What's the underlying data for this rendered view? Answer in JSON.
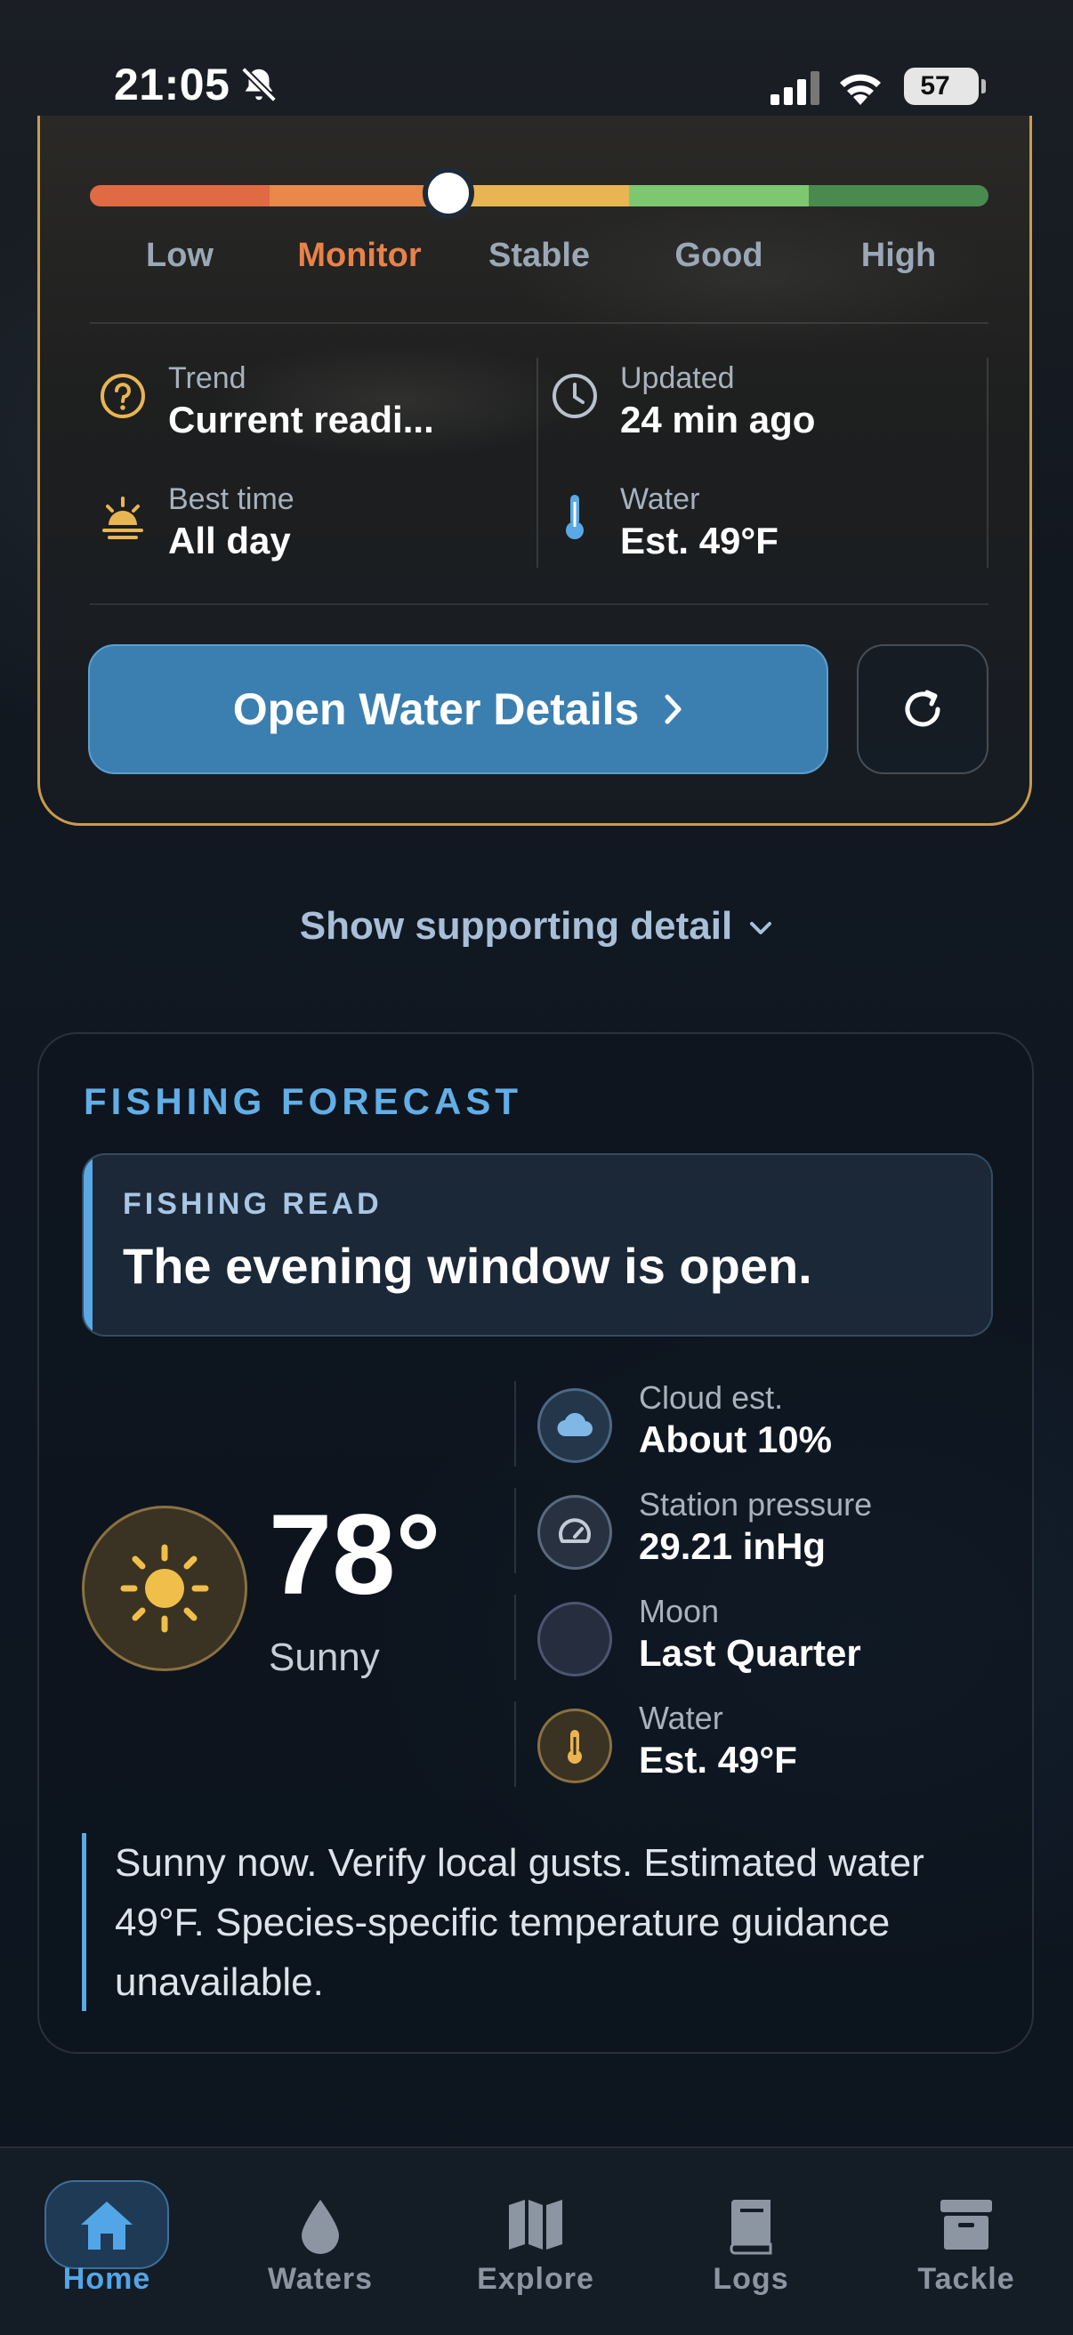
{
  "status_bar": {
    "time": "21:05",
    "battery": "57"
  },
  "water_card": {
    "scale": {
      "labels": [
        "Low",
        "Monitor",
        "Stable",
        "Good",
        "High"
      ],
      "active": "Monitor",
      "colors": [
        "#e06a44",
        "#e8884a",
        "#e9b552",
        "#7ec771",
        "#4a8a4e"
      ]
    },
    "trend": {
      "label": "Trend",
      "value": "Current readi..."
    },
    "updated": {
      "label": "Updated",
      "value": "24 min ago"
    },
    "best_time": {
      "label": "Best time",
      "value": "All day"
    },
    "water": {
      "label": "Water",
      "value": "Est. 49°F"
    },
    "open_button": "Open Water Details"
  },
  "show_detail": "Show supporting detail",
  "forecast": {
    "title": "FISHING FORECAST",
    "read_label": "FISHING READ",
    "read_text": "The evening window is open.",
    "temperature": "78°",
    "condition": "Sunny",
    "stats": [
      {
        "label": "Cloud est.",
        "value": "About 10%",
        "icon": "cloud-icon"
      },
      {
        "label": "Station pressure",
        "value": "29.21 inHg",
        "icon": "gauge-icon"
      },
      {
        "label": "Moon",
        "value": "Last Quarter",
        "icon": "moon-icon"
      },
      {
        "label": "Water",
        "value": "Est. 49°F",
        "icon": "thermometer-icon"
      }
    ],
    "summary": "Sunny now. Verify local gusts. Estimated water 49°F. Species-specific temperature guidance unavailable."
  },
  "tabbar": {
    "tabs": [
      {
        "label": "Home",
        "icon": "home-icon",
        "active": true
      },
      {
        "label": "Waters",
        "icon": "water-drop-icon"
      },
      {
        "label": "Explore",
        "icon": "map-icon"
      },
      {
        "label": "Logs",
        "icon": "book-icon"
      },
      {
        "label": "Tackle",
        "icon": "tackle-box-icon"
      }
    ]
  }
}
